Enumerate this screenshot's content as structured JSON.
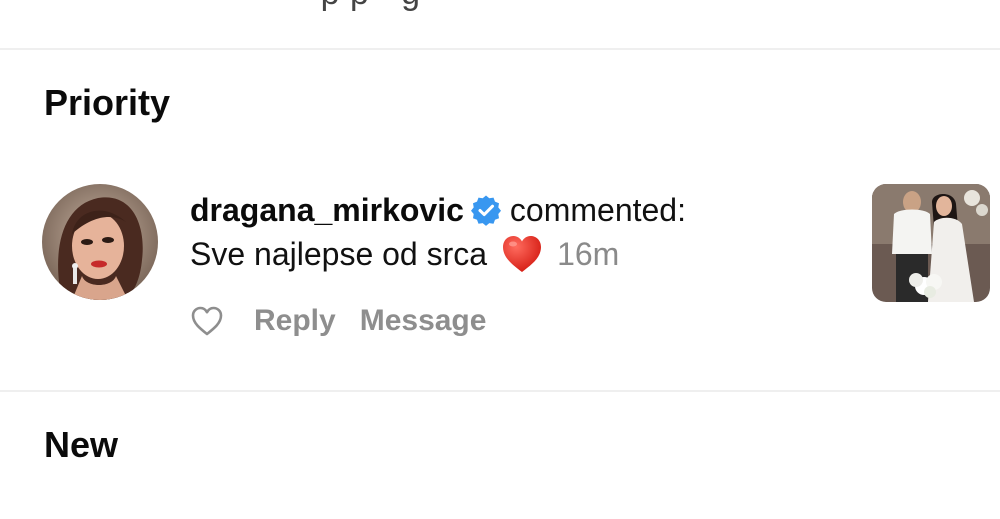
{
  "top_partial_text": "· · · · · · p p · g · · ·",
  "sections": {
    "priority_title": "Priority",
    "new_title": "New"
  },
  "notification": {
    "username": "dragana_mirkovic",
    "verified": true,
    "action": "commented:",
    "comment": "Sve najlepse od srca",
    "emoji": "red-heart",
    "time": "16m",
    "actions": {
      "reply_label": "Reply",
      "message_label": "Message"
    }
  },
  "colors": {
    "verified_blue": "#3897f0",
    "heart_red": "#e0241b",
    "muted_gray": "#8e8e8e"
  }
}
